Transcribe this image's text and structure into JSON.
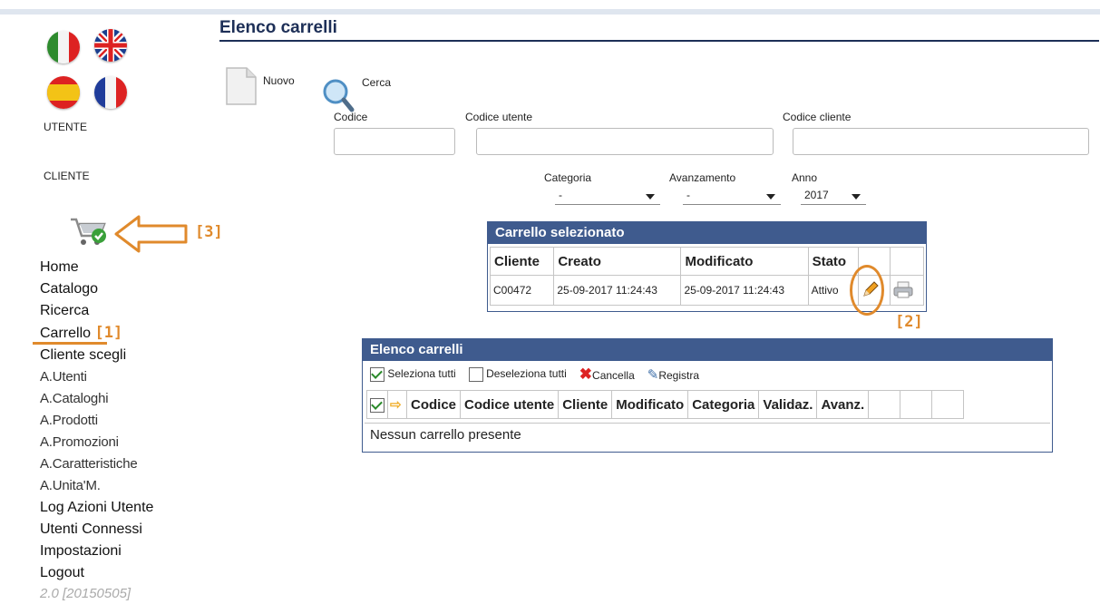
{
  "sidebar": {
    "label_utente": "UTENTE",
    "label_cliente": "CLIENTE",
    "items": [
      {
        "label": "Home"
      },
      {
        "label": "Catalogo"
      },
      {
        "label": "Ricerca"
      },
      {
        "label": "Carrello"
      },
      {
        "label": "Cliente scegli"
      },
      {
        "label": "A.Utenti"
      },
      {
        "label": "A.Cataloghi"
      },
      {
        "label": "A.Prodotti"
      },
      {
        "label": "A.Promozioni"
      },
      {
        "label": "A.Caratteristiche"
      },
      {
        "label": "A.Unita'M."
      },
      {
        "label": "Log Azioni Utente"
      },
      {
        "label": "Utenti Connessi"
      },
      {
        "label": "Impostazioni"
      },
      {
        "label": "Logout"
      }
    ],
    "version": "2.0 [20150505]"
  },
  "annotations": {
    "a1": "[1]",
    "a2": "[2]",
    "a3": "[3]"
  },
  "header": {
    "title": "Elenco carrelli"
  },
  "toolbar": {
    "new_label": "Nuovo",
    "search_label": "Cerca"
  },
  "filters": {
    "codice": {
      "label": "Codice",
      "value": ""
    },
    "codice_utente": {
      "label": "Codice utente",
      "value": ""
    },
    "codice_cliente": {
      "label": "Codice cliente",
      "value": ""
    },
    "categoria": {
      "label": "Categoria",
      "value": "-"
    },
    "avanzamento": {
      "label": "Avanzamento",
      "value": "-"
    },
    "anno": {
      "label": "Anno",
      "value": "2017"
    }
  },
  "selected_cart": {
    "title": "Carrello selezionato",
    "columns": [
      "Cliente",
      "Creato",
      "Modificato",
      "Stato"
    ],
    "row": {
      "cliente": "C00472",
      "creato": "25-09-2017 11:24:43",
      "modificato": "25-09-2017 11:24:43",
      "stato": "Attivo"
    }
  },
  "cart_list": {
    "title": "Elenco carrelli",
    "actions": {
      "select_all": "Seleziona tutti",
      "deselect_all": "Deseleziona tutti",
      "delete": "Cancella",
      "register": "Registra"
    },
    "columns": [
      "Codice",
      "Codice utente",
      "Cliente",
      "Modificato",
      "Categoria",
      "Validaz.",
      "Avanz."
    ],
    "empty_message": "Nessun carrello presente"
  },
  "colors": {
    "header_blue": "#3f5b8e",
    "title_navy": "#1d2f57",
    "annotation_orange": "#e08a2c"
  }
}
